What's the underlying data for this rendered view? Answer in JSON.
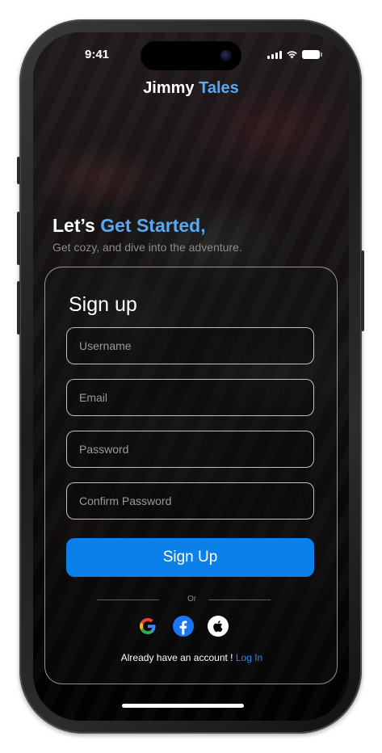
{
  "status_bar": {
    "time": "9:41"
  },
  "header": {
    "title_part1": "Jimmy",
    "title_part2": "Tales"
  },
  "hero": {
    "headline_part1": "Let’s",
    "headline_part2": "Get Started,",
    "subtitle": "Get cozy, and dive into the adventure."
  },
  "form": {
    "title": "Sign up",
    "username_placeholder": "Username",
    "email_placeholder": "Email",
    "password_placeholder": "Password",
    "confirm_password_placeholder": "Confirm Password",
    "submit_label": "Sign Up",
    "divider_text": "Or",
    "footer_text": "Already have an account !",
    "login_link": "Log In"
  },
  "social_icons": [
    "google-icon",
    "facebook-icon",
    "apple-icon"
  ],
  "colors": {
    "accent": "#5aa9f0",
    "primary_button": "#0a80e8",
    "link": "#2e8ae6",
    "facebook": "#1877f2"
  }
}
